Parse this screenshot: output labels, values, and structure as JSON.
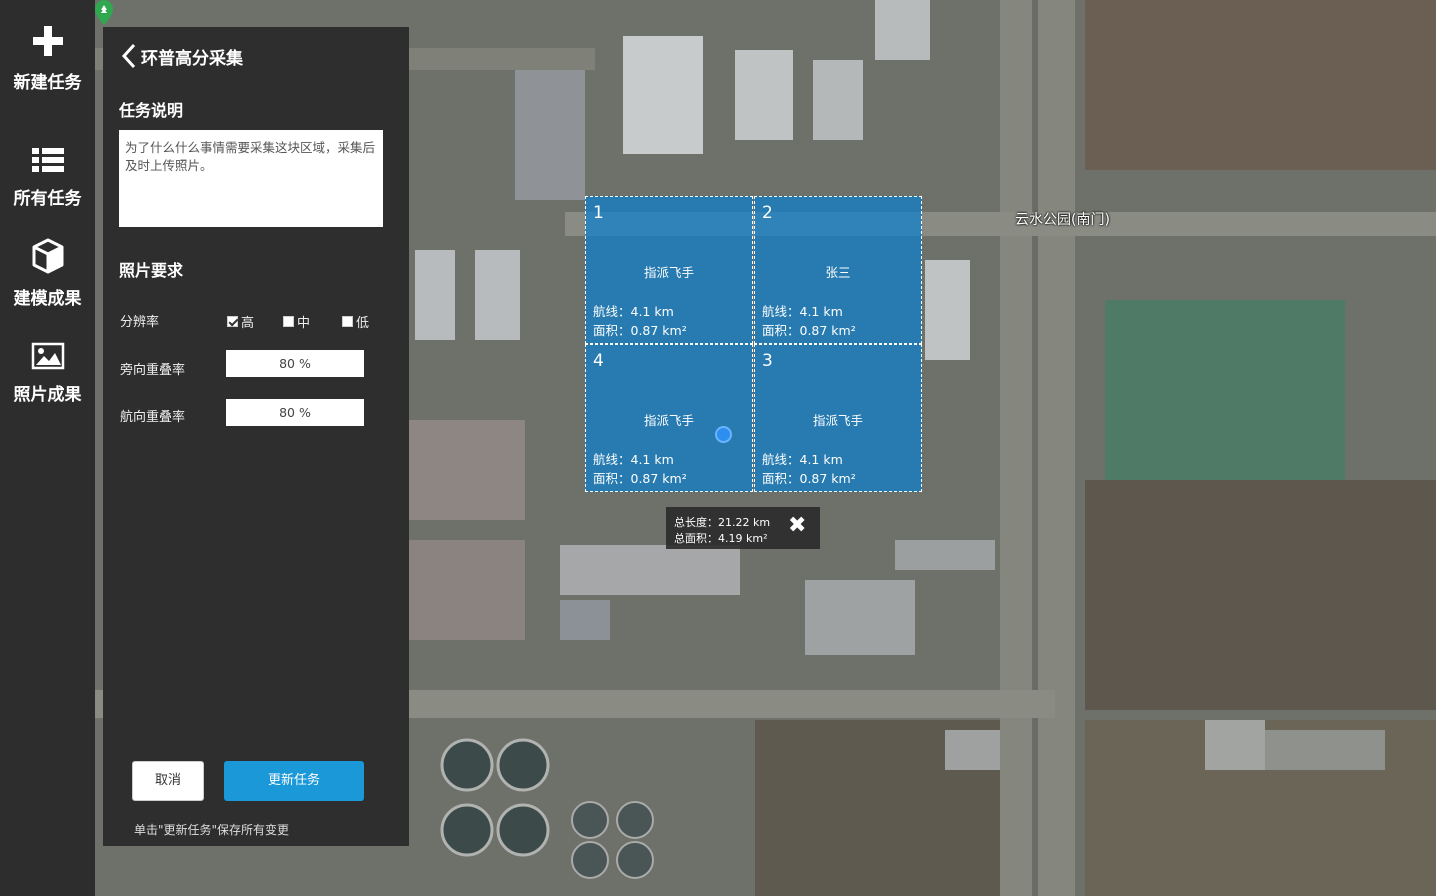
{
  "nav": {
    "items": [
      {
        "label": "新建任务",
        "icon": "plus-icon"
      },
      {
        "label": "所有任务",
        "icon": "list-icon"
      },
      {
        "label": "建模成果",
        "icon": "cube-icon"
      },
      {
        "label": "照片成果",
        "icon": "image-icon"
      }
    ]
  },
  "panel": {
    "title": "环普高分采集",
    "desc_title": "任务说明",
    "desc_text": "为了什么什么事情需要采集这块区域，采集后及时上传照片。",
    "photo_title": "照片要求",
    "resolution_label": "分辨率",
    "resolution_options": [
      {
        "label": "高",
        "checked": true
      },
      {
        "label": "中",
        "checked": false
      },
      {
        "label": "低",
        "checked": false
      }
    ],
    "side_overlap_label": "旁向重叠率",
    "side_overlap_value": "80 %",
    "forward_overlap_label": "航向重叠率",
    "forward_overlap_value": "80 %",
    "cancel_label": "取消",
    "update_label": "更新任务",
    "hint": "单击\"更新任务\"保存所有变更"
  },
  "map": {
    "poi_label": "云水公园(南门)",
    "cells": [
      {
        "num": "1",
        "assign": "指派飞手",
        "route": "航线：4.1 km",
        "area": "面积：0.87 km²"
      },
      {
        "num": "2",
        "assign": "张三",
        "route": "航线：4.1 km",
        "area": "面积：0.87 km²"
      },
      {
        "num": "4",
        "assign": "指派飞手",
        "route": "航线：4.1 km",
        "area": "面积：0.87 km²"
      },
      {
        "num": "3",
        "assign": "指派飞手",
        "route": "航线：4.1 km",
        "area": "面积：0.87 km²"
      }
    ],
    "total_length": "总长度：21.22 km",
    "total_area": "总面积：4.19 km²",
    "cell_color": "#0c80cd"
  }
}
